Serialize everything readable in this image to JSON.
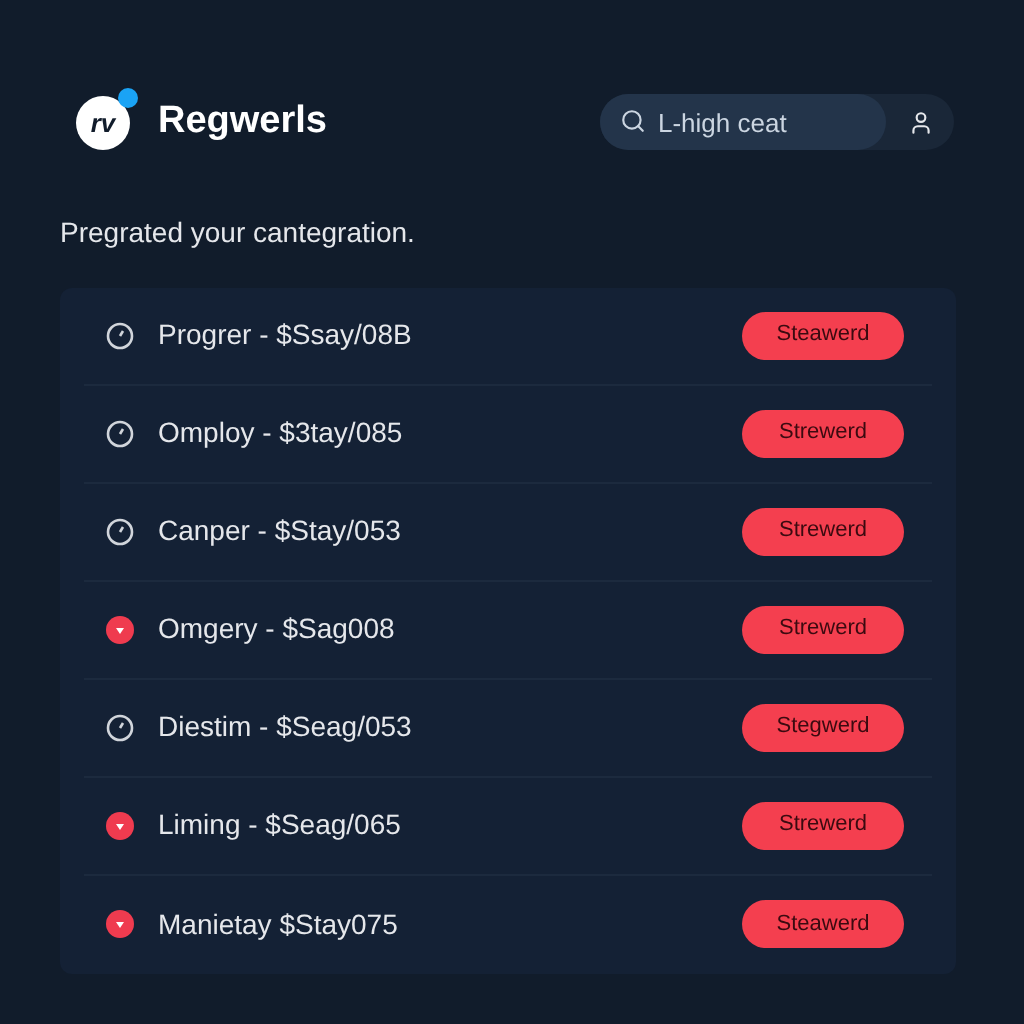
{
  "header": {
    "logo_text": "rv",
    "title": "Regwerls",
    "search": {
      "placeholder": "L-high ceat"
    }
  },
  "subtitle": "Pregrated your cantegration.",
  "items": [
    {
      "kind": "clock",
      "label": "Progrer - $Ssay/08B",
      "badge": "Steawerd"
    },
    {
      "kind": "clock",
      "label": "Omploy - $3tay/085",
      "badge": "Strewerd"
    },
    {
      "kind": "clock",
      "label": "Canper - $Stay/053",
      "badge": "Strewerd"
    },
    {
      "kind": "alert",
      "label": "Omgery - $Sag008",
      "badge": "Strewerd"
    },
    {
      "kind": "clock",
      "label": "Diestim - $Seag/053",
      "badge": "Stegwerd"
    },
    {
      "kind": "alert",
      "label": "Liming - $Seag/065",
      "badge": "Strewerd"
    },
    {
      "kind": "alert",
      "label": "Manietay $Stay075",
      "badge": "Steawerd"
    }
  ]
}
